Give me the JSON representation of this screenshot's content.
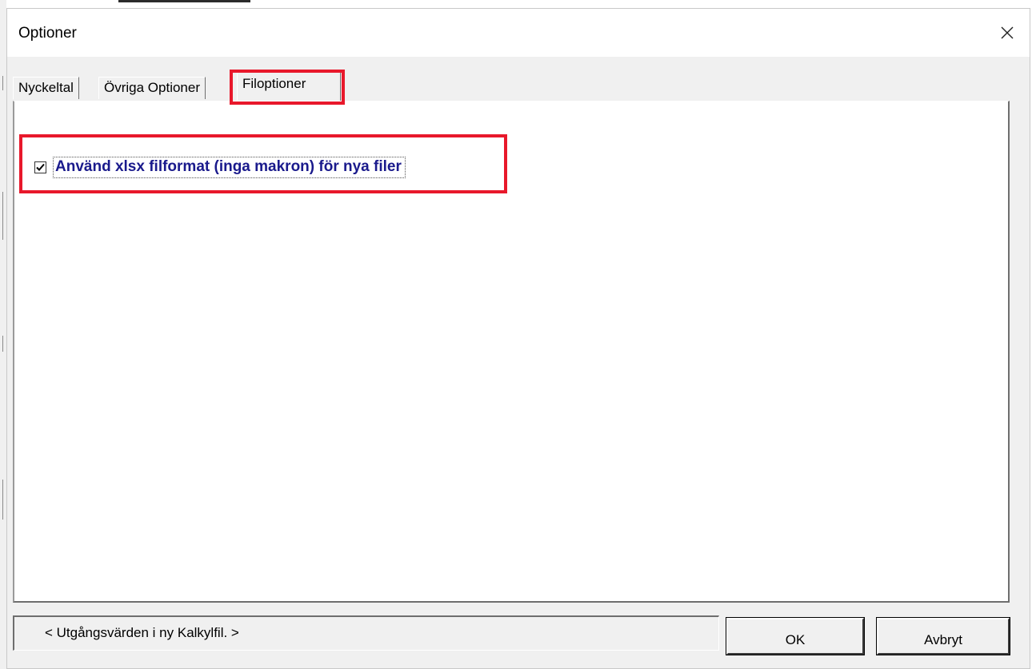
{
  "window": {
    "title": "Optioner",
    "close_icon": "close-icon"
  },
  "tabs": [
    {
      "label": "Nyckeltal",
      "active": false
    },
    {
      "label": "Övriga Optioner",
      "active": false
    },
    {
      "label": "Filoptioner",
      "active": true
    }
  ],
  "file_options": {
    "xlsx_checkbox_label": "Använd xlsx filformat (inga makron) för nya filer",
    "xlsx_checkbox_checked": true
  },
  "footer": {
    "status_text": "< Utgångsvärden i ny Kalkylfil. >",
    "ok_label": "OK",
    "cancel_label": "Avbryt"
  },
  "colors": {
    "highlight": "#e8182b",
    "checkbox_label": "#1a1a8c",
    "dialog_bg": "#f0f0f0"
  }
}
